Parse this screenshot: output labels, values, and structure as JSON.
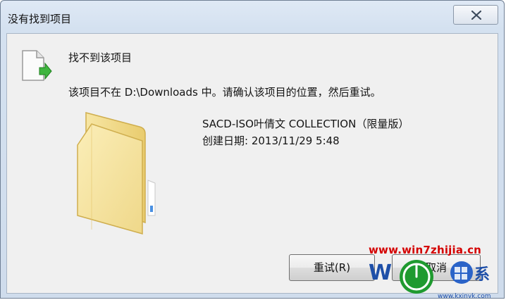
{
  "window": {
    "title": "没有找到项目"
  },
  "dialog": {
    "heading": "找不到该项目",
    "message": "该项目不在 D:\\Downloads 中。请确认该项目的位置，然后重试。",
    "item_name": "SACD-ISO叶倩文 COLLECTION（限量版）",
    "item_date": "创建日期: 2013/11/29 5:48"
  },
  "buttons": {
    "retry_label": "重试(R)",
    "cancel_label": "取消"
  },
  "watermark": {
    "url": "www.win7zhijia.cn",
    "bottom_url": "www.kxinyk.com"
  },
  "colors": {
    "title_bg": "#d4e1f0",
    "content_bg": "#f0f0f0",
    "folder": "#f4dd86",
    "watermark_red": "#d40000",
    "green_arrow": "#3fb53f"
  },
  "icons": {
    "close": "close-icon",
    "file": "file-arrow-icon",
    "folder": "folder-icon"
  }
}
